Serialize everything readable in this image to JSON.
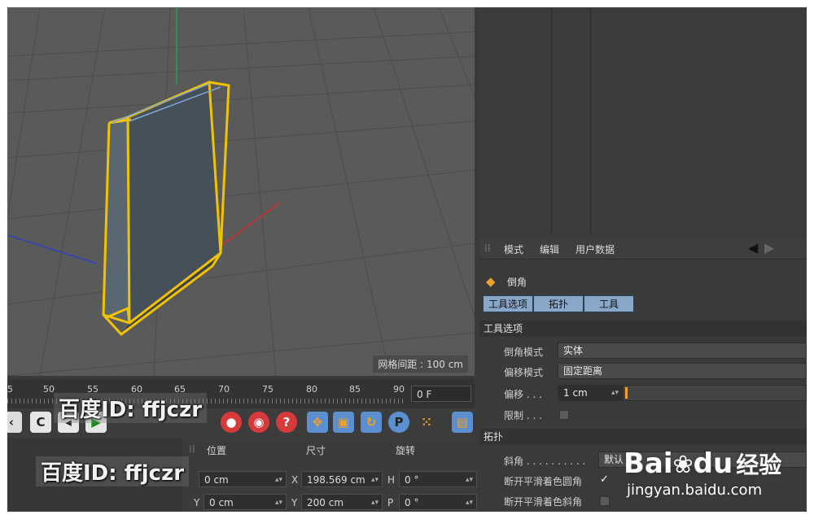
{
  "viewport": {
    "grid_label": "网格间距 : 100 cm"
  },
  "timeline": {
    "ruler": [
      "5",
      "50",
      "55",
      "60",
      "65",
      "70",
      "75",
      "80",
      "85",
      "90"
    ],
    "frame_value": "0 F"
  },
  "toolbar": {
    "icons": [
      "record-keys-icon",
      "play-back-icon",
      "play-forward-icon",
      "autokey-icon",
      "keyframe-icon",
      "help-icon",
      "move-icon",
      "scale-icon",
      "rotate-icon",
      "param-icon",
      "points-icon",
      "film-icon"
    ],
    "help_label": "?",
    "param_label": "P"
  },
  "coords": {
    "headers": {
      "position": "位置",
      "size": "尺寸",
      "rotation": "旋转"
    },
    "rows": [
      {
        "pos_value": "0 cm",
        "size_axis": "X",
        "size_value": "198.569 cm",
        "rot_axis": "H",
        "rot_value": "0 °"
      },
      {
        "pos_axis": "Y",
        "pos_value": "0 cm",
        "size_axis": "Y",
        "size_value": "200 cm",
        "rot_axis": "P",
        "rot_value": "0 °"
      }
    ]
  },
  "attributes": {
    "menu": [
      "模式",
      "编辑",
      "用户数据"
    ],
    "tool_name": "倒角",
    "tabs": [
      "工具选项",
      "拓扑",
      "工具"
    ],
    "section_tool_options": "工具选项",
    "bevel_mode_label": "倒角模式",
    "bevel_mode_value": "实体",
    "offset_mode_label": "偏移模式",
    "offset_mode_value": "固定距离",
    "offset_label": "偏移 . . .",
    "offset_value": "1 cm",
    "limit_label": "限制 . . .",
    "section_topology": "拓扑",
    "miter_label": "斜角 . . . . . . . . . .",
    "miter_value": "默认",
    "break_round_label": "断开平滑着色圆角",
    "break_round_check": "✓",
    "break_miter_label": "断开平滑着色斜角"
  },
  "watermark": {
    "id_text": "百度ID: ffjczr",
    "baidu_brand": "Bai",
    "baidu_brand2": "du",
    "baidu_cn": "经验",
    "url": "jingyan.baidu.com"
  },
  "colors": {
    "selection": "#f2c200",
    "tab_active": "#88a7c9",
    "axis_y": "#2ea043",
    "axis_x": "#d03030",
    "axis_z": "#3040c0"
  }
}
